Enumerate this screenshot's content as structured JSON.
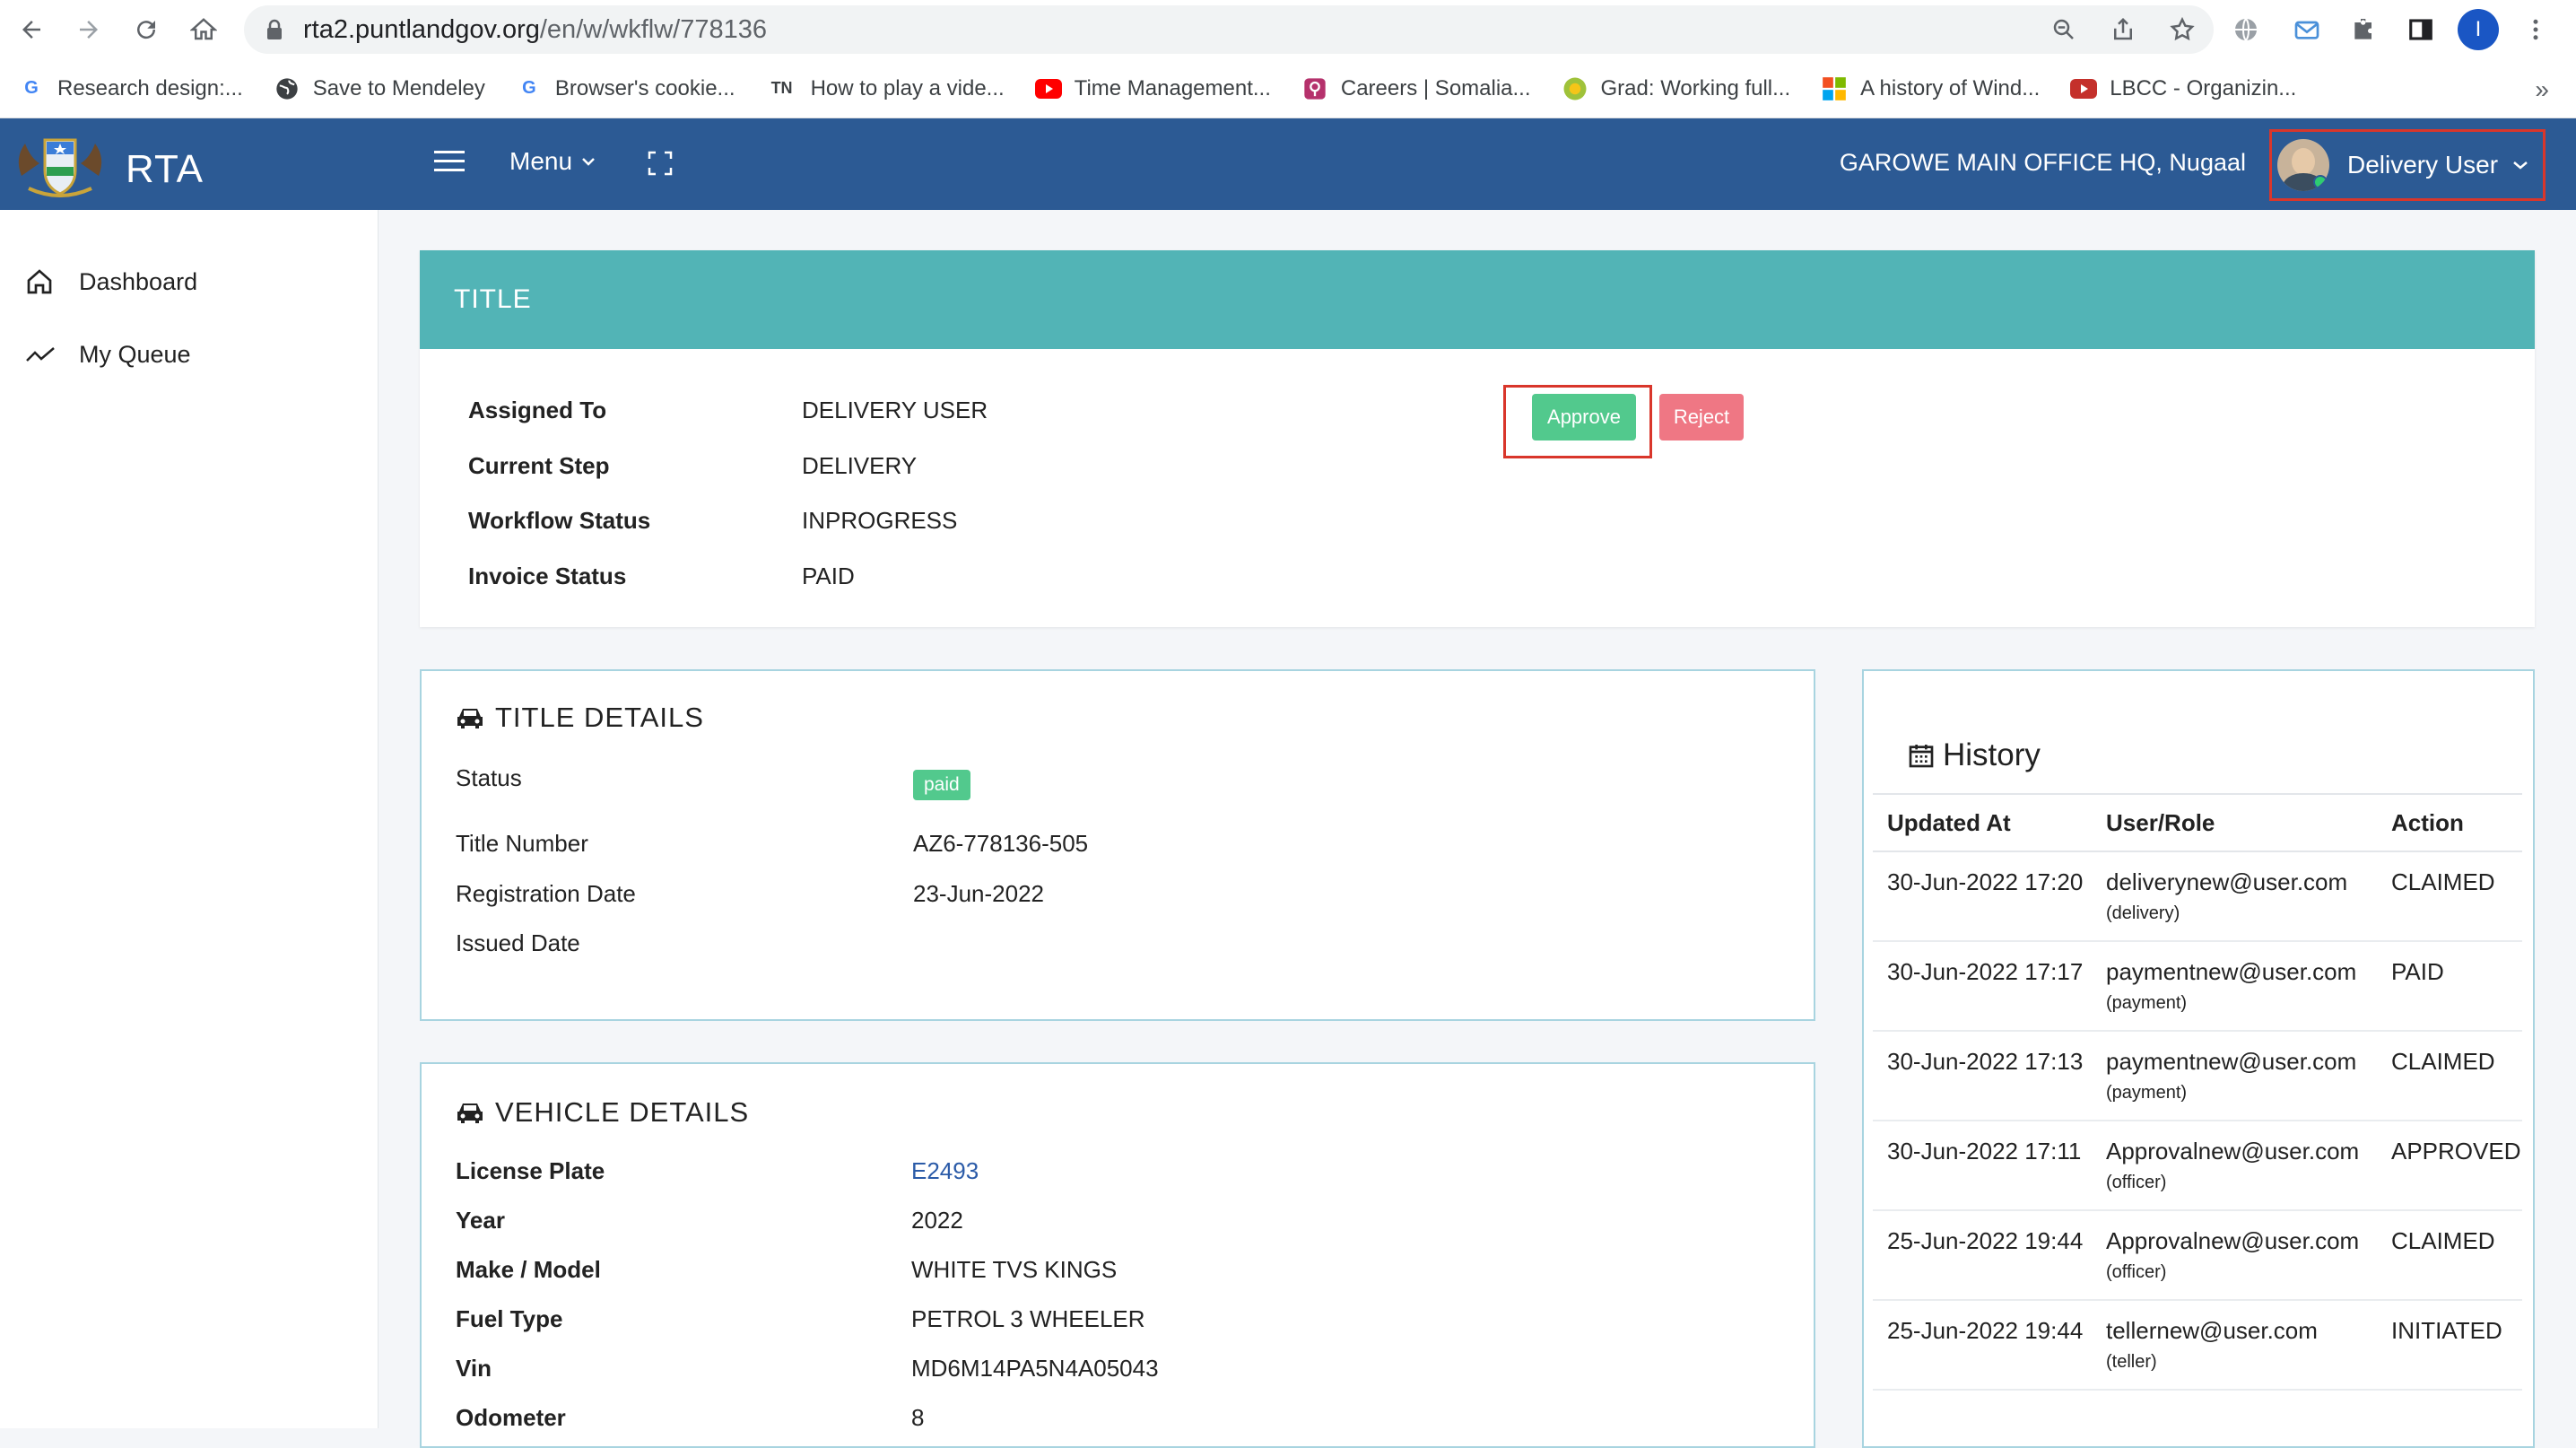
{
  "browser": {
    "url_host": "rta2.puntlandgov.org",
    "url_path": "/en/w/wkflw/778136",
    "profile_initial": "I"
  },
  "bookmarks": [
    {
      "label": "Research design:...",
      "icon": "google-icon"
    },
    {
      "label": "Save to Mendeley",
      "icon": "globe-icon"
    },
    {
      "label": "Browser's cookie...",
      "icon": "google-icon"
    },
    {
      "label": "How to play a vide...",
      "icon": "tn-icon"
    },
    {
      "label": "Time Management...",
      "icon": "youtube-icon"
    },
    {
      "label": "Careers | Somalia...",
      "icon": "careers-icon"
    },
    {
      "label": "Grad: Working full...",
      "icon": "grad-icon"
    },
    {
      "label": "A history of Wind...",
      "icon": "windows-icon"
    },
    {
      "label": "LBCC - Organizin...",
      "icon": "youtube-icon"
    }
  ],
  "bookmarks_overflow": "»",
  "header": {
    "brand": "RTA",
    "menu_label": "Menu",
    "office": "GAROWE MAIN OFFICE HQ, Nugaal",
    "user_name": "Delivery User",
    "color": "#2c5a94"
  },
  "sidebar": {
    "items": [
      {
        "label": "Dashboard",
        "icon": "home-icon"
      },
      {
        "label": "My Queue",
        "icon": "trend-icon"
      }
    ]
  },
  "title_card": {
    "heading": "TITLE",
    "rows": [
      {
        "key": "Assigned To",
        "value": "DELIVERY USER"
      },
      {
        "key": "Current Step",
        "value": "DELIVERY"
      },
      {
        "key": "Workflow Status",
        "value": "INPROGRESS"
      },
      {
        "key": "Invoice Status",
        "value": "PAID"
      }
    ],
    "approve_label": "Approve",
    "reject_label": "Reject",
    "accent": "#52b4b6"
  },
  "title_details": {
    "heading": "TITLE DETAILS",
    "status_label": "Status",
    "status_badge": "paid",
    "rows": [
      {
        "key": "Title Number",
        "value": "AZ6-778136-505"
      },
      {
        "key": "Registration Date",
        "value": "23-Jun-2022"
      },
      {
        "key": "Issued Date",
        "value": ""
      }
    ]
  },
  "vehicle_details": {
    "heading": "VEHICLE DETAILS",
    "rows": [
      {
        "key": "License Plate",
        "value": "E2493"
      },
      {
        "key": "Year",
        "value": "2022"
      },
      {
        "key": "Make / Model",
        "value": "WHITE TVS KINGS"
      },
      {
        "key": "Fuel Type",
        "value": "PETROL 3 WHEELER"
      },
      {
        "key": "Vin",
        "value": "MD6M14PA5N4A05043"
      },
      {
        "key": "Odometer",
        "value": "8"
      }
    ]
  },
  "history": {
    "heading": "History",
    "columns": [
      "Updated At",
      "User/Role",
      "Action"
    ],
    "rows": [
      {
        "updated": "30-Jun-2022 17:20",
        "user": "deliverynew@user.com",
        "role": "(delivery)",
        "action": "CLAIMED"
      },
      {
        "updated": "30-Jun-2022 17:17",
        "user": "paymentnew@user.com",
        "role": "(payment)",
        "action": "PAID"
      },
      {
        "updated": "30-Jun-2022 17:13",
        "user": "paymentnew@user.com",
        "role": "(payment)",
        "action": "CLAIMED"
      },
      {
        "updated": "30-Jun-2022 17:11",
        "user": "Approvalnew@user.com",
        "role": "(officer)",
        "action": "APPROVED"
      },
      {
        "updated": "25-Jun-2022 19:44",
        "user": "Approvalnew@user.com",
        "role": "(officer)",
        "action": "CLAIMED"
      },
      {
        "updated": "25-Jun-2022 19:44",
        "user": "tellernew@user.com",
        "role": "(teller)",
        "action": "INITIATED"
      }
    ]
  }
}
